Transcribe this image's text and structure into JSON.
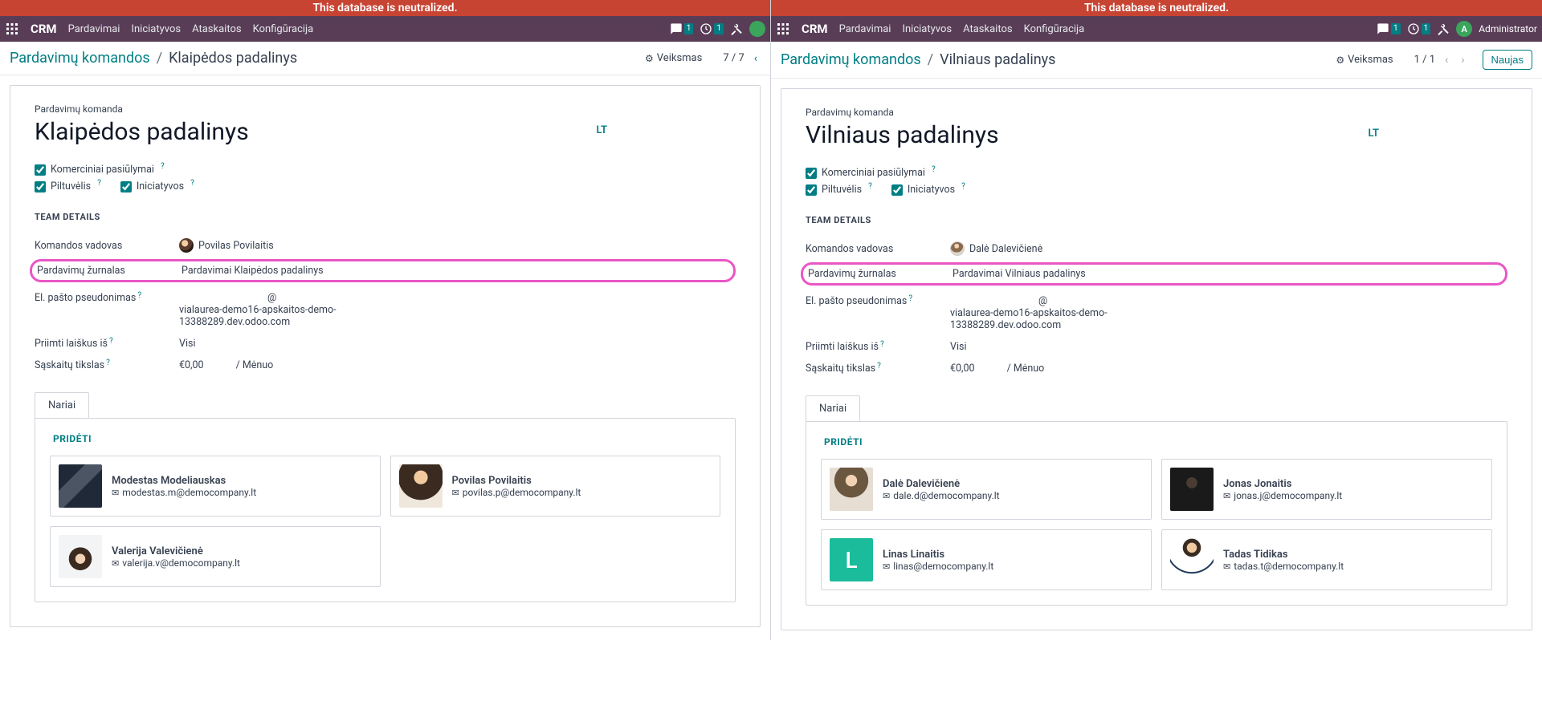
{
  "warning_banner": "This database is neutralized.",
  "topbar": {
    "brand": "CRM",
    "nav": [
      "Pardavimai",
      "Iniciatyvos",
      "Ataskaitos",
      "Konfigūracija"
    ],
    "chat_badge": "1",
    "clock_badge": "1",
    "admin_initial": "A",
    "admin_name": "Administrator"
  },
  "left": {
    "breadcrumb_root": "Pardavimų komandos",
    "breadcrumb_current": "Klaipėdos padalinys",
    "action_label": "Veiksmas",
    "pager": "7 / 7",
    "lang_badge": "LT",
    "small_label": "Pardavimų komanda",
    "title": "Klaipėdos padalinys",
    "chk_offers": "Komerciniai pasiūlymai",
    "chk_funnel": "Piltuvėlis",
    "chk_leads": "Iniciatyvos",
    "section_team_details": "TEAM DETAILS",
    "label_leader": "Komandos vadovas",
    "leader_name": "Povilas Povilaitis",
    "label_journal": "Pardavimų žurnalas",
    "journal_value": "Pardavimai Klaipėdos padalinys",
    "label_email": "El. pašto pseudonimas",
    "email_at": "@",
    "email_domain": "vialaurea-demo16-apskaitos-demo-13388289.dev.odoo.com",
    "label_accept": "Priimti laiškus iš",
    "accept_value": "Visi",
    "label_target": "Sąskaitų tikslas",
    "target_value": "€0,00",
    "target_per": "/ Mėnuo",
    "tab_members": "Nariai",
    "add_label": "PRIDĖTI",
    "members": [
      {
        "name": "Modestas Modeliauskas",
        "email": "modestas.m@democompany.lt",
        "cls": "mimg-mm",
        "initial": ""
      },
      {
        "name": "Povilas Povilaitis",
        "email": "povilas.p@democompany.lt",
        "cls": "mimg-pp",
        "initial": ""
      },
      {
        "name": "Valerija Valevičienė",
        "email": "valerija.v@democompany.lt",
        "cls": "mimg-vv",
        "initial": ""
      }
    ]
  },
  "right": {
    "breadcrumb_root": "Pardavimų komandos",
    "breadcrumb_current": "Vilniaus padalinys",
    "action_label": "Veiksmas",
    "pager": "1 / 1",
    "new_button": "Naujas",
    "lang_badge": "LT",
    "small_label": "Pardavimų komanda",
    "title": "Vilniaus padalinys",
    "chk_offers": "Komerciniai pasiūlymai",
    "chk_funnel": "Piltuvėlis",
    "chk_leads": "Iniciatyvos",
    "section_team_details": "TEAM DETAILS",
    "label_leader": "Komandos vadovas",
    "leader_name": "Dalė Dalevičienė",
    "label_journal": "Pardavimų žurnalas",
    "journal_value": "Pardavimai Vilniaus padalinys",
    "label_email": "El. pašto pseudonimas",
    "email_at": "@",
    "email_domain": "vialaurea-demo16-apskaitos-demo-13388289.dev.odoo.com",
    "label_accept": "Priimti laiškus iš",
    "accept_value": "Visi",
    "label_target": "Sąskaitų tikslas",
    "target_value": "€0,00",
    "target_per": "/ Mėnuo",
    "tab_members": "Nariai",
    "add_label": "PRIDĖTI",
    "members": [
      {
        "name": "Dalė Dalevičienė",
        "email": "dale.d@democompany.lt",
        "cls": "mimg-dd",
        "initial": ""
      },
      {
        "name": "Jonas Jonaitis",
        "email": "jonas.j@democompany.lt",
        "cls": "mimg-jj",
        "initial": ""
      },
      {
        "name": "Linas Linaitis",
        "email": "linas@democompany.lt",
        "cls": "mimg-ll",
        "initial": "L"
      },
      {
        "name": "Tadas Tidikas",
        "email": "tadas.t@democompany.lt",
        "cls": "mimg-tt",
        "initial": ""
      }
    ]
  }
}
